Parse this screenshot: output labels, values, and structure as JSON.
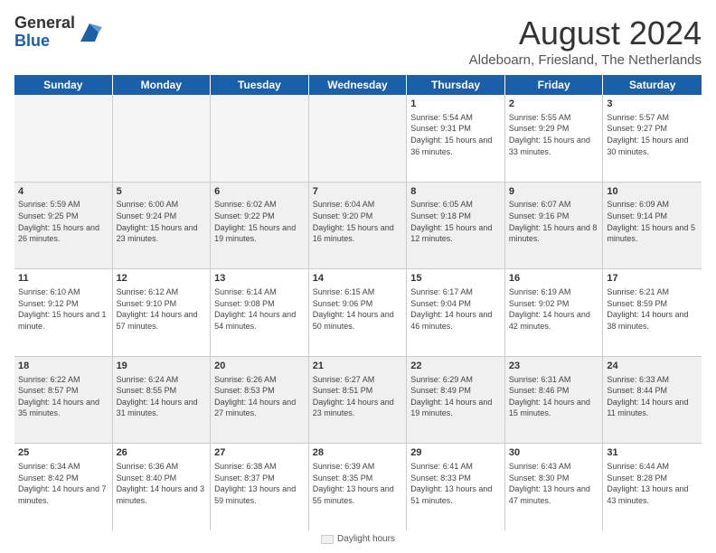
{
  "header": {
    "logo_general": "General",
    "logo_blue": "Blue",
    "month_title": "August 2024",
    "location": "Aldeboarn, Friesland, The Netherlands"
  },
  "days_of_week": [
    "Sunday",
    "Monday",
    "Tuesday",
    "Wednesday",
    "Thursday",
    "Friday",
    "Saturday"
  ],
  "footer": {
    "legend_label": "Daylight hours",
    "note": ""
  },
  "weeks": [
    [
      {
        "day": "",
        "info": "",
        "empty": true
      },
      {
        "day": "",
        "info": "",
        "empty": true
      },
      {
        "day": "",
        "info": "",
        "empty": true
      },
      {
        "day": "",
        "info": "",
        "empty": true
      },
      {
        "day": "1",
        "info": "Sunrise: 5:54 AM\nSunset: 9:31 PM\nDaylight: 15 hours\nand 36 minutes."
      },
      {
        "day": "2",
        "info": "Sunrise: 5:55 AM\nSunset: 9:29 PM\nDaylight: 15 hours\nand 33 minutes."
      },
      {
        "day": "3",
        "info": "Sunrise: 5:57 AM\nSunset: 9:27 PM\nDaylight: 15 hours\nand 30 minutes."
      }
    ],
    [
      {
        "day": "4",
        "info": "Sunrise: 5:59 AM\nSunset: 9:25 PM\nDaylight: 15 hours\nand 26 minutes."
      },
      {
        "day": "5",
        "info": "Sunrise: 6:00 AM\nSunset: 9:24 PM\nDaylight: 15 hours\nand 23 minutes."
      },
      {
        "day": "6",
        "info": "Sunrise: 6:02 AM\nSunset: 9:22 PM\nDaylight: 15 hours\nand 19 minutes."
      },
      {
        "day": "7",
        "info": "Sunrise: 6:04 AM\nSunset: 9:20 PM\nDaylight: 15 hours\nand 16 minutes."
      },
      {
        "day": "8",
        "info": "Sunrise: 6:05 AM\nSunset: 9:18 PM\nDaylight: 15 hours\nand 12 minutes."
      },
      {
        "day": "9",
        "info": "Sunrise: 6:07 AM\nSunset: 9:16 PM\nDaylight: 15 hours\nand 8 minutes."
      },
      {
        "day": "10",
        "info": "Sunrise: 6:09 AM\nSunset: 9:14 PM\nDaylight: 15 hours\nand 5 minutes."
      }
    ],
    [
      {
        "day": "11",
        "info": "Sunrise: 6:10 AM\nSunset: 9:12 PM\nDaylight: 15 hours\nand 1 minute."
      },
      {
        "day": "12",
        "info": "Sunrise: 6:12 AM\nSunset: 9:10 PM\nDaylight: 14 hours\nand 57 minutes."
      },
      {
        "day": "13",
        "info": "Sunrise: 6:14 AM\nSunset: 9:08 PM\nDaylight: 14 hours\nand 54 minutes."
      },
      {
        "day": "14",
        "info": "Sunrise: 6:15 AM\nSunset: 9:06 PM\nDaylight: 14 hours\nand 50 minutes."
      },
      {
        "day": "15",
        "info": "Sunrise: 6:17 AM\nSunset: 9:04 PM\nDaylight: 14 hours\nand 46 minutes."
      },
      {
        "day": "16",
        "info": "Sunrise: 6:19 AM\nSunset: 9:02 PM\nDaylight: 14 hours\nand 42 minutes."
      },
      {
        "day": "17",
        "info": "Sunrise: 6:21 AM\nSunset: 8:59 PM\nDaylight: 14 hours\nand 38 minutes."
      }
    ],
    [
      {
        "day": "18",
        "info": "Sunrise: 6:22 AM\nSunset: 8:57 PM\nDaylight: 14 hours\nand 35 minutes."
      },
      {
        "day": "19",
        "info": "Sunrise: 6:24 AM\nSunset: 8:55 PM\nDaylight: 14 hours\nand 31 minutes."
      },
      {
        "day": "20",
        "info": "Sunrise: 6:26 AM\nSunset: 8:53 PM\nDaylight: 14 hours\nand 27 minutes."
      },
      {
        "day": "21",
        "info": "Sunrise: 6:27 AM\nSunset: 8:51 PM\nDaylight: 14 hours\nand 23 minutes."
      },
      {
        "day": "22",
        "info": "Sunrise: 6:29 AM\nSunset: 8:49 PM\nDaylight: 14 hours\nand 19 minutes."
      },
      {
        "day": "23",
        "info": "Sunrise: 6:31 AM\nSunset: 8:46 PM\nDaylight: 14 hours\nand 15 minutes."
      },
      {
        "day": "24",
        "info": "Sunrise: 6:33 AM\nSunset: 8:44 PM\nDaylight: 14 hours\nand 11 minutes."
      }
    ],
    [
      {
        "day": "25",
        "info": "Sunrise: 6:34 AM\nSunset: 8:42 PM\nDaylight: 14 hours\nand 7 minutes."
      },
      {
        "day": "26",
        "info": "Sunrise: 6:36 AM\nSunset: 8:40 PM\nDaylight: 14 hours\nand 3 minutes."
      },
      {
        "day": "27",
        "info": "Sunrise: 6:38 AM\nSunset: 8:37 PM\nDaylight: 13 hours\nand 59 minutes."
      },
      {
        "day": "28",
        "info": "Sunrise: 6:39 AM\nSunset: 8:35 PM\nDaylight: 13 hours\nand 55 minutes."
      },
      {
        "day": "29",
        "info": "Sunrise: 6:41 AM\nSunset: 8:33 PM\nDaylight: 13 hours\nand 51 minutes."
      },
      {
        "day": "30",
        "info": "Sunrise: 6:43 AM\nSunset: 8:30 PM\nDaylight: 13 hours\nand 47 minutes."
      },
      {
        "day": "31",
        "info": "Sunrise: 6:44 AM\nSunset: 8:28 PM\nDaylight: 13 hours\nand 43 minutes."
      }
    ]
  ]
}
